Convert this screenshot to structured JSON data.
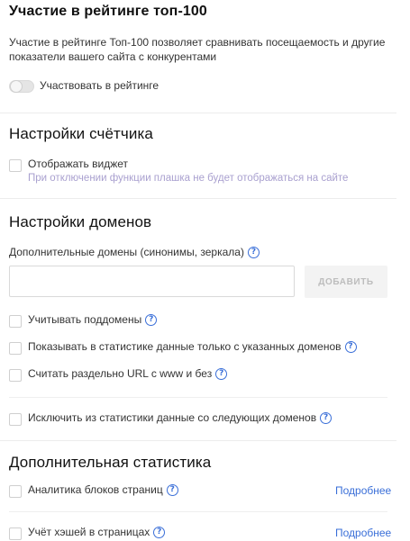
{
  "rating": {
    "title": "Участие в рейтинге топ-100",
    "description_line1": "Участие в рейтинге Топ-100 позволяет сравнивать посещаемость и другие",
    "description_line2": "показатели вашего сайта с конкурентами",
    "toggle_label": "Участвовать в рейтинге",
    "toggle_on": false
  },
  "counter": {
    "title": "Настройки счётчика",
    "widget_label": "Отображать виджет",
    "widget_hint": "При отключении функции плашка не будет отображаться на сайте"
  },
  "domains": {
    "title": "Настройки доменов",
    "extra_domains_label": "Дополнительные домены (синонимы, зеркала)",
    "input_value": "",
    "input_placeholder": "",
    "add_button": "ДОБАВИТЬ",
    "subdomains_label": "Учитывать поддомены",
    "only_listed_label": "Показывать в статистике данные только с указанных доменов",
    "www_separate_label": "Считать раздельно URL с www и без",
    "exclude_label": "Исключить из статистики данные со следующих доменов"
  },
  "extra_stats": {
    "title": "Дополнительная статистика",
    "blocks_label": "Аналитика блоков страниц",
    "blocks_link": "Подробнее",
    "hashes_label": "Учёт хэшей в страницах",
    "hashes_link": "Подробнее"
  },
  "icons": {
    "help": "?"
  },
  "colors": {
    "accent": "#3a6fd8",
    "hint": "#a9a0cf",
    "divider": "#ececec"
  }
}
